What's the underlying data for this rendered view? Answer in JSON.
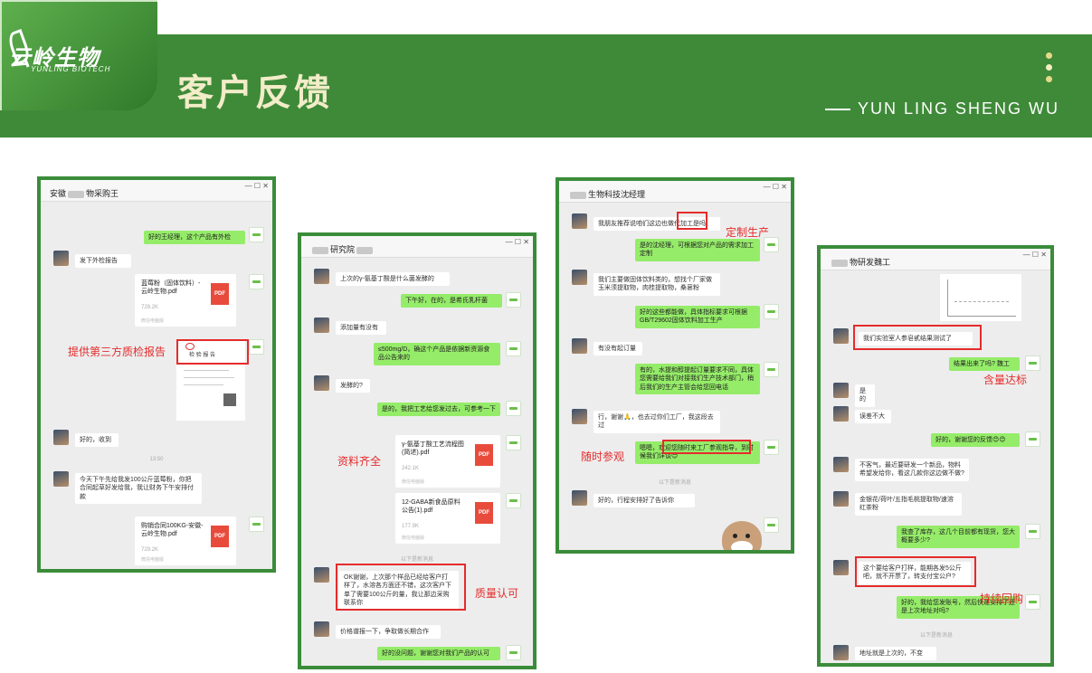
{
  "header": {
    "logo_text": "云岭生物",
    "logo_sub": "YUNLING BIOTECH",
    "title": "客户反馈",
    "subtitle": "YUN LING SHENG WU"
  },
  "colors": {
    "brand_green": "#3f8a39",
    "title_cream": "#f2ecc8",
    "highlight_red": "#e52b2b",
    "dot_yellow": "#e8d98a"
  },
  "card1": {
    "title_pre": "安徽",
    "title_post": "物采购王",
    "msgs": [
      "好的王经理，这个产品有外检",
      "发下外检报告",
      "好的，收到",
      "今天下午先给我发100公斤蓝莓粉，你把合同起草好发给我，我让财务下午安排付款"
    ],
    "file1": {
      "name": "蓝莓粉（固体饮料）-云岭生物.pdf",
      "size": "729.2K",
      "src": "微信电脑版"
    },
    "file2": {
      "name": "购销合同100KG-安徽-云岭生物.pdf",
      "size": "729.2K",
      "src": "微信电脑版"
    },
    "report_title": "检 验 报 告",
    "time": "13:50",
    "label": "提供第三方质检报告"
  },
  "card2": {
    "title_pre": "",
    "title_post": "研究院",
    "msgs": [
      "上次的γ-氨基丁酸是什么菌发酵的",
      "下午好，在的，是希氏乳杆菌",
      "添加量有没有",
      "≤500mg/D，确这个产品是依据新资源食品公告来的",
      "发酵的?",
      "是的，我把工艺给您发过去，可参考一下",
      "OK谢谢，上次那个样品已经给客户打样了，水溶各方面还不错，这次客户下单了需要100公斤的量，我让那边采购联系你",
      "价格谱报一下，争取做长期合作",
      "好的没问题，谢谢您对我们产品的认可"
    ],
    "file1": {
      "name": "γ-氨基丁酸工艺流程图(简述).pdf",
      "size": "242.1K",
      "src": "微信电脑版"
    },
    "file2": {
      "name": "12-GABA新食品原料公告(1).pdf",
      "size": "177.9K",
      "src": "微信电脑版"
    },
    "divider": "以下是新消息",
    "label1": "资料齐全",
    "label2": "质量认可"
  },
  "card3": {
    "title_pre": "",
    "title_post": "生物科技沈经理",
    "msgs": [
      "我朋友推荐说咱们这边也做代加工是吗",
      "是的沈经理，可根据您对产品的需求加工定制",
      "我们主要做固体饮料类的，想找个厂家做玉米须提取物，肉桂提取物，桑葚粉",
      "好的这些都能做，具体指标要求可根据GB/T29602固体饮料加工生产",
      "有没有起订量",
      "有的，水提和醇提起订量要求不同，具体您需要给我们对接我们生产技术部门，稍后我们的生产主管会给您回电话",
      "行，谢谢🙏，也去过你们工厂，我这段去过",
      "嗯嗯，欢迎您随时来工厂参观指导，到时候我们详谈😊",
      "好的，行程安排好了告诉你"
    ],
    "divider": "以下是新消息",
    "label1": "定制生产",
    "label2": "随时参观"
  },
  "card4": {
    "title_pre": "",
    "title_post": "物研发魏工",
    "msgs": [
      "我们实验室人参皂甙结果测试了",
      "结果出来了吗? 魏工",
      "是的",
      "误差不大",
      "好的，谢谢您的反馈😊😊",
      "不客气，最近要研发一个新品，物料希望发给你，看这几款你这边做不做?",
      "金银花/荷叶/五指毛桃提取物/速溶红茶粉",
      "我查了库存，这几个目前都有现货，您大概要多少?",
      "这个要给客户打样，能期各发5公斤吧，就不开票了，转支付宝公户?",
      "好的，我给您发账号，然后快递安排了还是上次地址对吗?",
      "地址就是上次的，不变"
    ],
    "divider": "以下是新消息",
    "label1": "含量达标",
    "label2": "持续回购"
  }
}
